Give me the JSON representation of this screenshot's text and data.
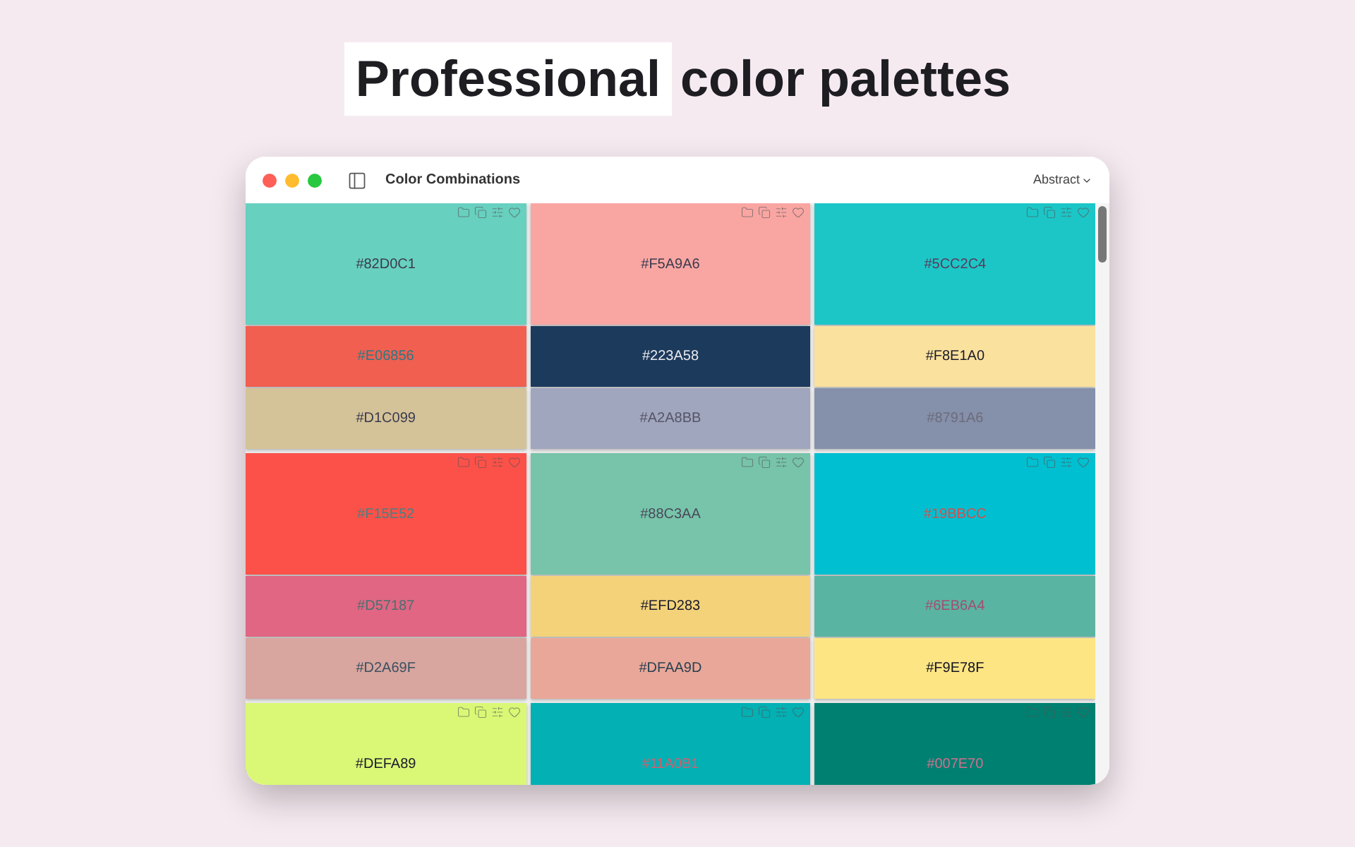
{
  "headline": [
    {
      "text": "Professional",
      "highlighted": true
    },
    {
      "text": "color palettes",
      "highlighted": false
    }
  ],
  "window": {
    "title": "Color Combinations",
    "category_menu": "Abstract"
  },
  "palettes": [
    {
      "swatches": [
        {
          "color": "#68d0bf",
          "label": {
            "text": "#82D0C1",
            "color": "#3b3b4d"
          }
        },
        {
          "color": "#f05f50",
          "label": {
            "text": "#E06856",
            "color": "#2a7a86"
          }
        },
        {
          "color": "#d4c298",
          "label": {
            "text": "#D1C099",
            "color": "#3a3a50"
          }
        }
      ]
    },
    {
      "swatches": [
        {
          "color": "#f9a6a3",
          "label": {
            "text": "#F5A9A6",
            "color": "#3b3b4d"
          }
        },
        {
          "color": "#1c3a5c",
          "label": {
            "text": "#223A58",
            "color": "#e8e8ee"
          }
        },
        {
          "color": "#a1a6bf",
          "label": {
            "text": "#A2A8BB",
            "color": "#555566"
          }
        }
      ]
    },
    {
      "swatches": [
        {
          "color": "#1cc6c7",
          "label": {
            "text": "#5CC2C4",
            "color": "#5a3a5a"
          }
        },
        {
          "color": "#fae19d",
          "label": {
            "text": "#F8E1A0",
            "color": "#1a1a2a"
          }
        },
        {
          "color": "#8590aa",
          "label": {
            "text": "#8791A6",
            "color": "#6c6c7c"
          }
        }
      ]
    },
    {
      "swatches": [
        {
          "color": "#fc5149",
          "label": {
            "text": "#F15E52",
            "color": "#4a8080"
          }
        },
        {
          "color": "#e06683",
          "label": {
            "text": "#D57187",
            "color": "#4a7070"
          }
        },
        {
          "color": "#d8a59f",
          "label": {
            "text": "#D2A69F",
            "color": "#3a5060"
          }
        }
      ]
    },
    {
      "swatches": [
        {
          "color": "#77c4aa",
          "label": {
            "text": "#88C3AA",
            "color": "#4a4a5a"
          }
        },
        {
          "color": "#f3d27a",
          "label": {
            "text": "#EFD283",
            "color": "#1a1a2a"
          }
        },
        {
          "color": "#e9a799",
          "label": {
            "text": "#DFAA9D",
            "color": "#2a4050"
          }
        }
      ]
    },
    {
      "swatches": [
        {
          "color": "#00bfd0",
          "label": {
            "text": "#19BBCC",
            "color": "#d05050"
          }
        },
        {
          "color": "#5ab4a2",
          "label": {
            "text": "#6EB6A4",
            "color": "#a05070"
          }
        },
        {
          "color": "#fde583",
          "label": {
            "text": "#F9E78F",
            "color": "#101020"
          }
        }
      ]
    },
    {
      "swatches": [
        {
          "color": "#daf876",
          "label": {
            "text": "#DEFA89",
            "color": "#1a1a2a"
          }
        }
      ]
    },
    {
      "swatches": [
        {
          "color": "#03b0b3",
          "label": {
            "text": "#11A0B1",
            "color": "#d06070"
          }
        }
      ]
    },
    {
      "swatches": [
        {
          "color": "#008070",
          "label": {
            "text": "#007E70",
            "color": "#d07090"
          }
        }
      ]
    }
  ]
}
